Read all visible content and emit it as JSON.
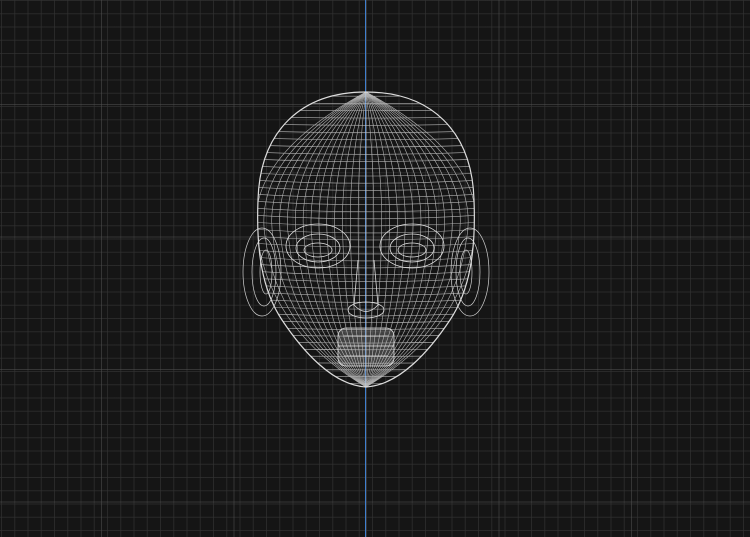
{
  "viewport": {
    "mode": "wireframe",
    "object": "head-mesh"
  },
  "colors": {
    "background": "#151515",
    "grid_minor": "#323232",
    "grid_major": "#505050",
    "axis": "#3f7fcf",
    "wire": "#d0d0d0"
  }
}
